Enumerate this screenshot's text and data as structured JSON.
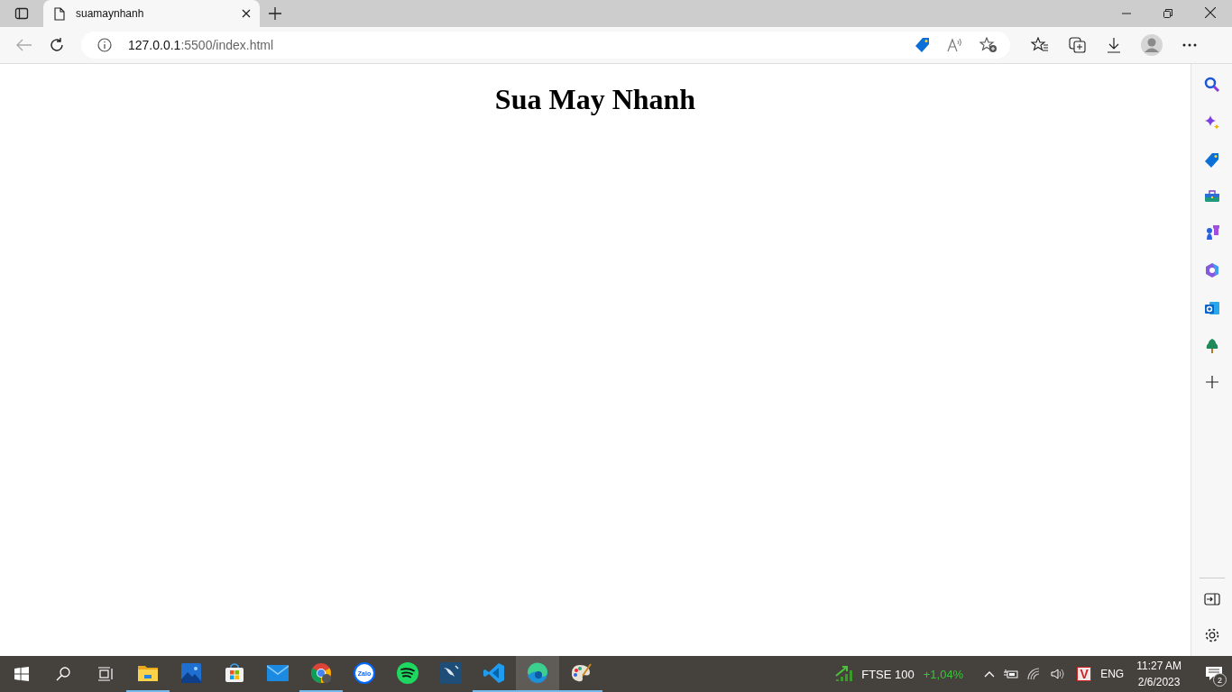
{
  "tab": {
    "title": "suamaynhanh",
    "selected": true
  },
  "address": {
    "host": "127.0.0.1",
    "rest": ":5500/index.html"
  },
  "page": {
    "heading": "Sua May Nhanh"
  },
  "sidebar": [
    {
      "kind": "search"
    },
    {
      "kind": "sparkle"
    },
    {
      "kind": "tag"
    },
    {
      "kind": "toolbox"
    },
    {
      "kind": "games"
    },
    {
      "kind": "hexagon"
    },
    {
      "kind": "mail"
    },
    {
      "kind": "tree"
    },
    {
      "kind": "plus"
    }
  ],
  "taskbar": {
    "apps": [
      {
        "kind": "folder",
        "running": true,
        "selected": false
      },
      {
        "kind": "photos",
        "running": false,
        "selected": false
      },
      {
        "kind": "store",
        "running": false,
        "selected": false
      },
      {
        "kind": "mail",
        "running": false,
        "selected": false
      },
      {
        "kind": "chrome",
        "running": true,
        "selected": false
      },
      {
        "kind": "chat",
        "label": "Zalo",
        "running": false,
        "selected": false
      },
      {
        "kind": "music",
        "running": false,
        "selected": false
      },
      {
        "kind": "dolphin",
        "running": false,
        "selected": false
      },
      {
        "kind": "code",
        "running": true,
        "selected": false
      },
      {
        "kind": "edge",
        "running": true,
        "selected": true
      },
      {
        "kind": "paint",
        "running": true,
        "selected": false
      }
    ]
  },
  "stock": {
    "name": "FTSE 100",
    "change": "+1,04%"
  },
  "tray_app_letter": "V",
  "language": "ENG",
  "time": "11:27 AM",
  "date": "2/6/2023",
  "notifications": "2"
}
